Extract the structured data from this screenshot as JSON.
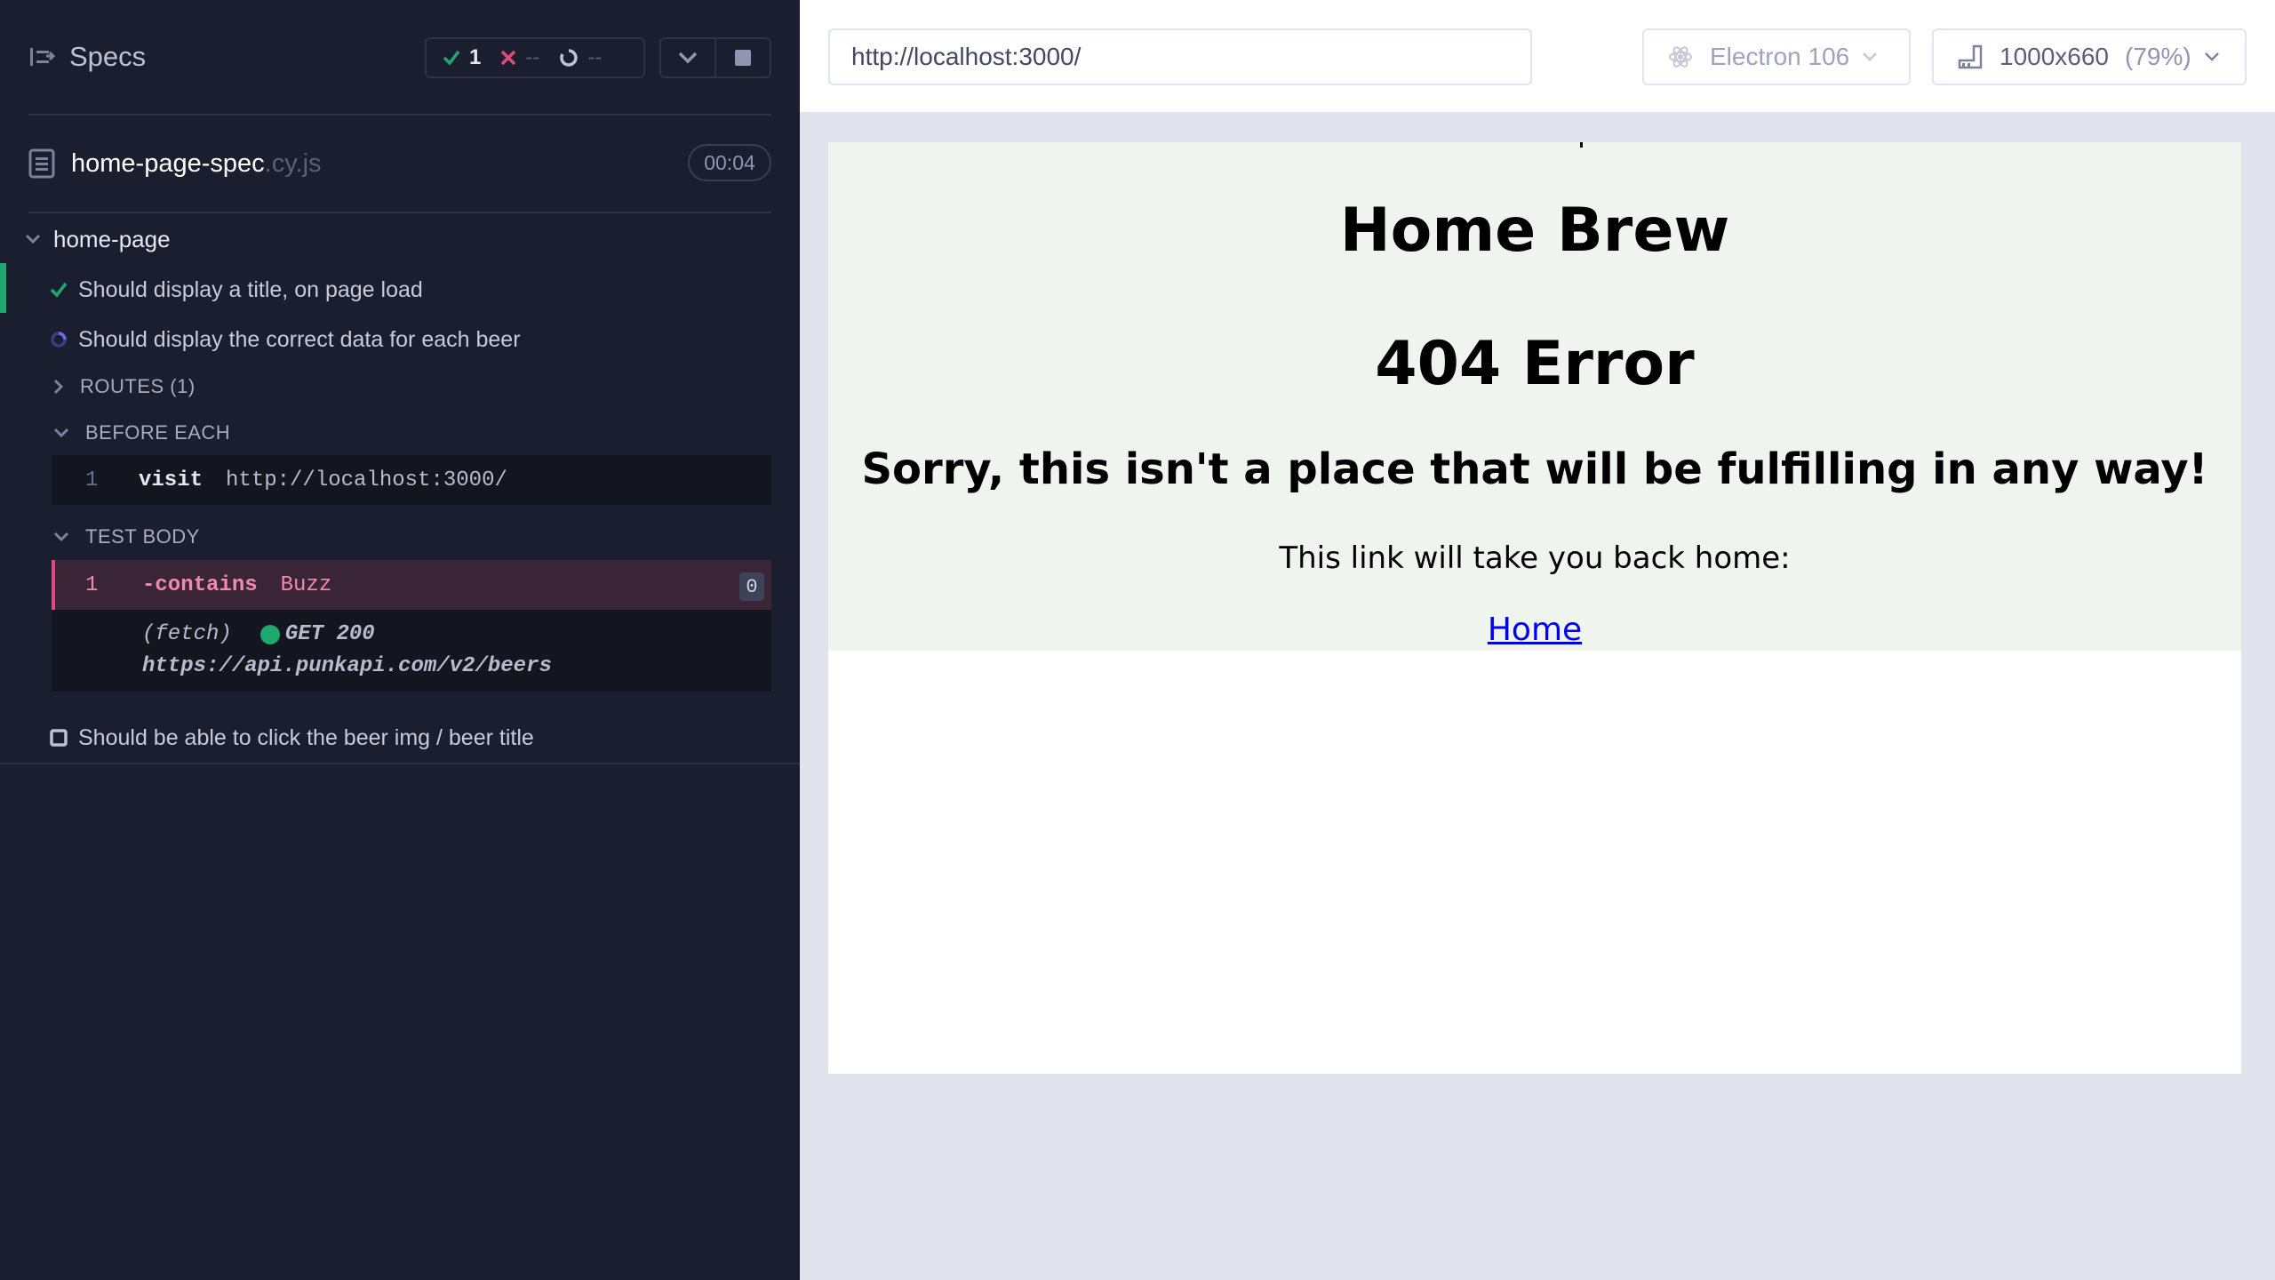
{
  "reporter": {
    "specs_label": "Specs",
    "stats": {
      "passed": "1",
      "failed": "--",
      "pending": "--"
    },
    "spec": {
      "name": "home-page-spec",
      "ext": ".cy.js",
      "duration": "00:04"
    },
    "suite": {
      "name": "home-page"
    },
    "tests": [
      {
        "title": "Should display a title, on page load",
        "state": "passed"
      },
      {
        "title": "Should display the correct data for each beer",
        "state": "running"
      },
      {
        "title": "Should be able to click the beer img / beer title",
        "state": "pending"
      }
    ],
    "sections": {
      "routes": "ROUTES (1)",
      "before_each": "BEFORE EACH",
      "test_body": "TEST BODY"
    },
    "before_each_cmd": {
      "num": "1",
      "name": "visit",
      "message": "http://localhost:3000/"
    },
    "test_body_cmd": {
      "num": "1",
      "name": "-contains",
      "message": "Buzz",
      "badge": "0"
    },
    "fetch": {
      "label": "(fetch)",
      "status": "GET 200",
      "url": "https://api.punkapi.com/v2/beers"
    },
    "colors": {
      "pass": "#1fa971",
      "fail": "#e04b7e",
      "running": "#6470f3"
    }
  },
  "aut": {
    "url": "http://localhost:3000/",
    "browser": "Electron 106",
    "viewport": "1000x660",
    "zoom": "(79%)"
  },
  "app": {
    "title": "Home Brew",
    "error": "404 Error",
    "message": "Sorry, this isn't a place that will be fulfilling in any way!",
    "link_text": "This link will take you back home:",
    "home_link": "Home"
  }
}
